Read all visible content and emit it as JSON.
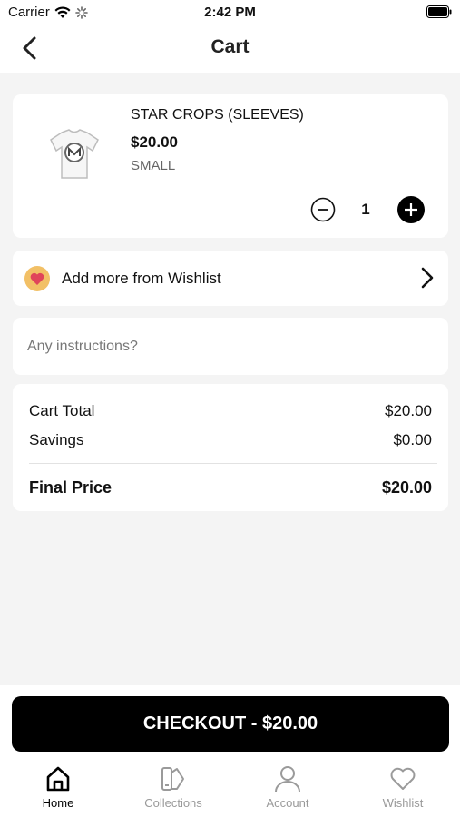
{
  "status_bar": {
    "carrier": "Carrier",
    "time": "2:42 PM"
  },
  "nav": {
    "title": "Cart"
  },
  "cart_item": {
    "name": "STAR CROPS (SLEEVES)",
    "price": "$20.00",
    "size": "SMALL",
    "quantity": "1"
  },
  "wishlist_row": {
    "label": "Add more from Wishlist"
  },
  "instructions": {
    "placeholder": "Any instructions?",
    "value": ""
  },
  "summary": {
    "cart_total_label": "Cart Total",
    "cart_total_value": "$20.00",
    "savings_label": "Savings",
    "savings_value": "$0.00",
    "final_label": "Final Price",
    "final_value": "$20.00"
  },
  "checkout": {
    "label": "CHECKOUT - $20.00"
  },
  "tabs": [
    {
      "label": "Home",
      "icon": "home-icon",
      "active": true
    },
    {
      "label": "Collections",
      "icon": "collections-icon",
      "active": false
    },
    {
      "label": "Account",
      "icon": "account-icon",
      "active": false
    },
    {
      "label": "Wishlist",
      "icon": "heart-icon",
      "active": false
    }
  ],
  "colors": {
    "accent": "#000000",
    "background": "#f4f4f4",
    "wishlist_badge": "#f2c066",
    "heart": "#e0455a"
  }
}
